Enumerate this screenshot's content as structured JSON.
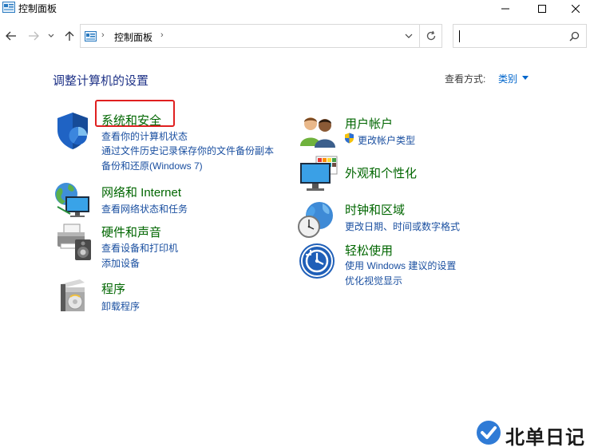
{
  "window": {
    "title": "控制面板"
  },
  "address": {
    "path_item": "控制面板"
  },
  "main": {
    "heading": "调整计算机的设置",
    "view_by_label": "查看方式:",
    "view_by_value": "类别"
  },
  "categories": {
    "system": {
      "title": "系统和安全",
      "links": [
        "查看你的计算机状态",
        "通过文件历史记录保存你的文件备份副本",
        "备份和还原(Windows 7)"
      ]
    },
    "network": {
      "title": "网络和 Internet",
      "links": [
        "查看网络状态和任务"
      ]
    },
    "hardware": {
      "title": "硬件和声音",
      "links": [
        "查看设备和打印机",
        "添加设备"
      ]
    },
    "programs": {
      "title": "程序",
      "links": [
        "卸载程序"
      ]
    },
    "user": {
      "title": "用户帐户",
      "links": [
        "更改帐户类型"
      ]
    },
    "appearance": {
      "title": "外观和个性化",
      "links": []
    },
    "clock": {
      "title": "时钟和区域",
      "links": [
        "更改日期、时间或数字格式"
      ]
    },
    "ease": {
      "title": "轻松使用",
      "links": [
        "使用 Windows 建议的设置",
        "优化视觉显示"
      ]
    }
  },
  "watermark": {
    "text": "北单日记"
  },
  "colors": {
    "category_title": "#006600",
    "link": "#1a4fa0",
    "heading": "#1e3287",
    "highlight_box": "#e02020"
  }
}
